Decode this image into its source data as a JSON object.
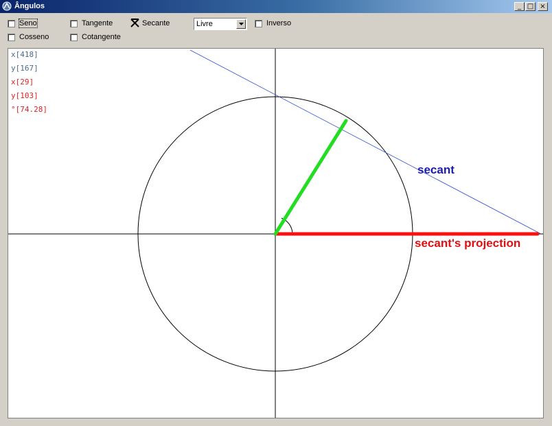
{
  "window": {
    "title": "Ângulos"
  },
  "titlebar_buttons": {
    "minimize": "_",
    "maximize": "□",
    "close": "×"
  },
  "options": {
    "seno": {
      "label": "Seno",
      "checked": false
    },
    "cosseno": {
      "label": "Cosseno",
      "checked": false
    },
    "tangente": {
      "label": "Tangente",
      "checked": false
    },
    "cotangente": {
      "label": "Cotangente",
      "checked": false
    },
    "secante": {
      "label": "Secante",
      "checked": true
    },
    "inverso": {
      "label": "Inverso",
      "checked": false
    }
  },
  "mode_select": {
    "value": "Livre"
  },
  "readouts": [
    {
      "text": "x[418]",
      "color": "#4a6a8a"
    },
    {
      "text": "y[167]",
      "color": "#4a6a8a"
    },
    {
      "text": "x[29]",
      "color": "#e02020"
    },
    {
      "text": "y[103]",
      "color": "#e02020"
    },
    {
      "text": "°[74.28]",
      "color": "#e02020"
    }
  ],
  "labels": {
    "secant": "secant",
    "projection": "secant's projection"
  },
  "colors": {
    "radius": "#22dd22",
    "projection": "#ff1010",
    "secant_line": "#3050d0",
    "circle": "#000000"
  }
}
